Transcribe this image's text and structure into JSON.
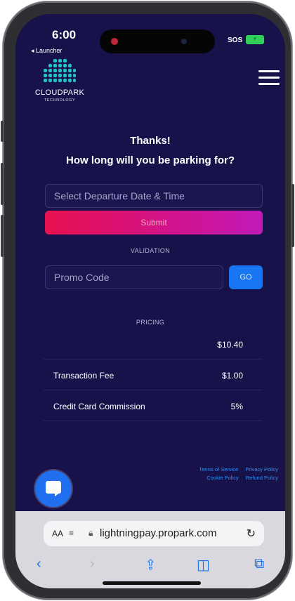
{
  "status": {
    "time": "6:00",
    "back_app": "◂ Launcher",
    "sos": "SOS",
    "battery": "⚡"
  },
  "brand": {
    "name": "CLOUDPARK",
    "tagline": "TECHNOLOGY",
    "accent": "#1ec8c4"
  },
  "heading": {
    "thanks": "Thanks!",
    "question": "How long will you be parking for?"
  },
  "departure": {
    "placeholder": "Select Departure Date & Time"
  },
  "submit_label": "Submit",
  "validation": {
    "label": "VALIDATION",
    "promo_placeholder": "Promo Code",
    "go_label": "GO"
  },
  "pricing": {
    "label": "PRICING",
    "rows": [
      {
        "label": "",
        "value": "$10.40"
      },
      {
        "label": "Transaction Fee",
        "value": "$1.00"
      },
      {
        "label": "Credit Card Commission",
        "value": "5%"
      }
    ]
  },
  "footer": {
    "links": [
      "Terms of Service",
      "Privacy Policy",
      "Cookie Policy",
      "Refund Policy"
    ]
  },
  "browser": {
    "text_size": "AA",
    "url": "lightningpay.propark.com"
  },
  "colors": {
    "background": "#17124a",
    "submit_gradient_start": "#e8114f",
    "submit_gradient_end": "#c21ab8",
    "go_button": "#1976f2",
    "link": "#2f8ff5"
  },
  "icons": [
    "hamburger-menu-icon",
    "chat-icon",
    "reload-icon",
    "back-icon",
    "forward-icon",
    "share-icon",
    "bookmarks-icon",
    "tabs-icon",
    "lock-icon"
  ]
}
